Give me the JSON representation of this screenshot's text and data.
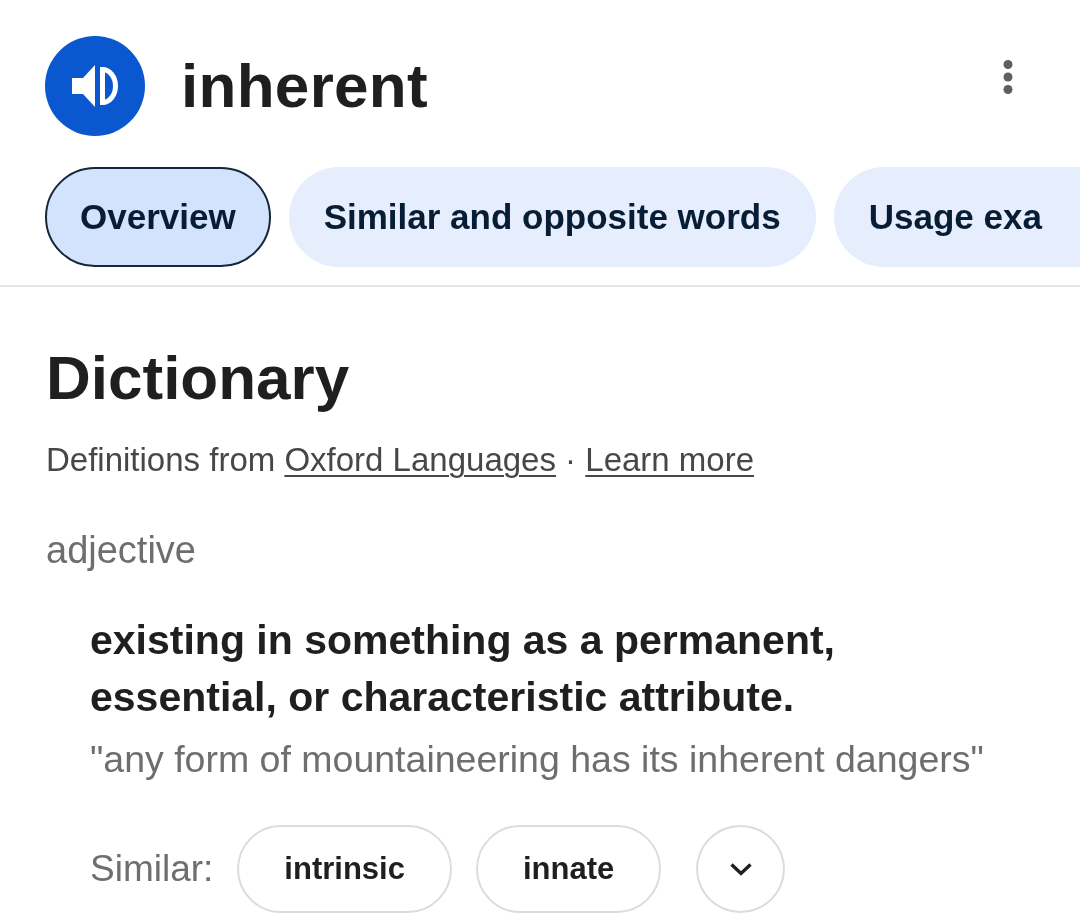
{
  "header": {
    "word": "inherent"
  },
  "tabs": [
    {
      "label": "Overview",
      "selected": true
    },
    {
      "label": "Similar and opposite words",
      "selected": false
    },
    {
      "label": "Usage exa",
      "selected": false
    }
  ],
  "dictionary": {
    "title": "Dictionary",
    "source": {
      "text": "Definitions from",
      "link": "Oxford Languages",
      "separator": "·",
      "more_link": "Learn more"
    },
    "part_of_speech": "adjective",
    "senses": [
      {
        "definition": "existing in something as a permanent, essential, or characteristic attribute.",
        "example": "\"any form of mountaineering has its inherent dangers\"",
        "similar_label": "Similar:",
        "similar": [
          "intrinsic",
          "innate"
        ]
      }
    ]
  }
}
